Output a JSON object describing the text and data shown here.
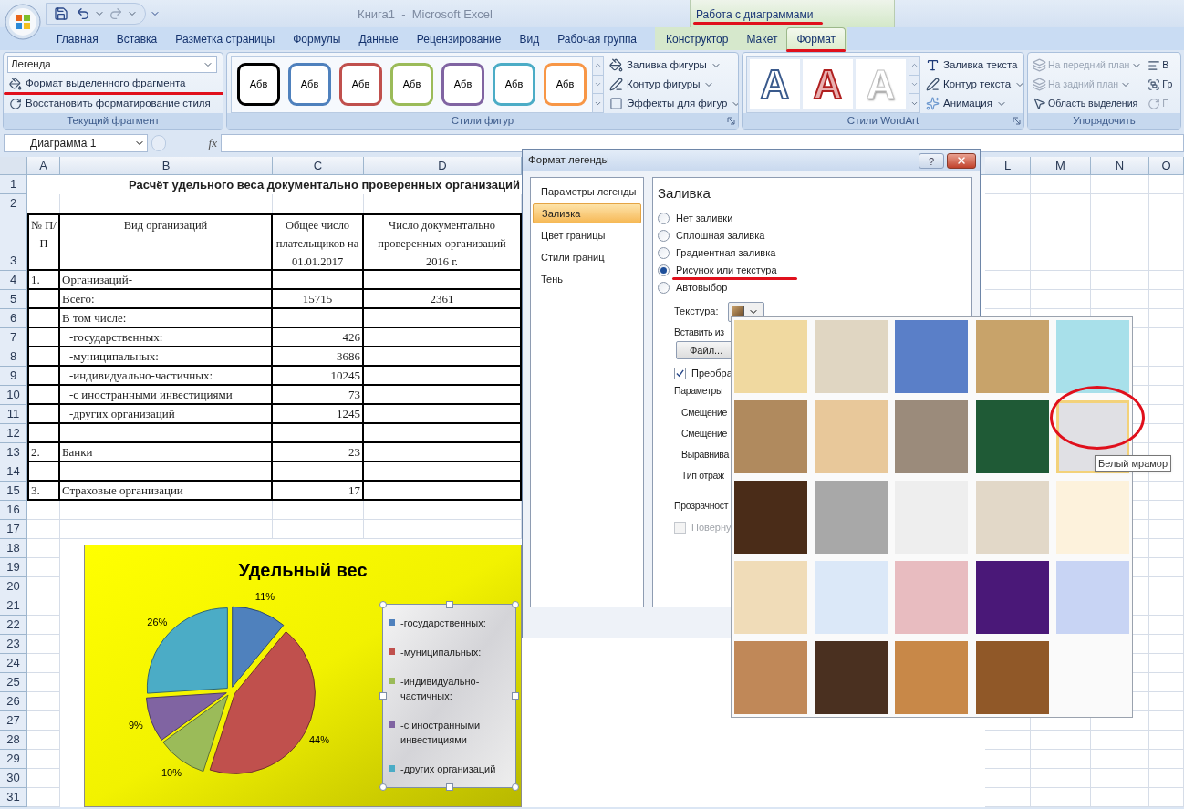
{
  "title_bar": {
    "document_title": "Книга1  -  Microsoft Excel",
    "context_group": "Работа с диаграммами",
    "context_annotated": true
  },
  "tabs": [
    {
      "label": "Главная",
      "selected": false,
      "contextual": false,
      "annotated": false
    },
    {
      "label": "Вставка",
      "selected": false,
      "contextual": false,
      "annotated": false
    },
    {
      "label": "Разметка страницы",
      "selected": false,
      "contextual": false,
      "annotated": false
    },
    {
      "label": "Формулы",
      "selected": false,
      "contextual": false,
      "annotated": false
    },
    {
      "label": "Данные",
      "selected": false,
      "contextual": false,
      "annotated": false
    },
    {
      "label": "Рецензирование",
      "selected": false,
      "contextual": false,
      "annotated": false
    },
    {
      "label": "Вид",
      "selected": false,
      "contextual": false,
      "annotated": false
    },
    {
      "label": "Рабочая группа",
      "selected": false,
      "contextual": false,
      "annotated": false
    },
    {
      "label": "Конструктор",
      "selected": false,
      "contextual": true,
      "annotated": false
    },
    {
      "label": "Макет",
      "selected": false,
      "contextual": true,
      "annotated": false
    },
    {
      "label": "Формат",
      "selected": true,
      "contextual": true,
      "annotated": true
    }
  ],
  "ribbon": {
    "current_selection": {
      "label": "Текущий фрагмент",
      "element_dropdown": "Легенда",
      "buttons": [
        {
          "label": "Формат выделенного фрагмента",
          "annotated": true
        },
        {
          "label": "Восстановить форматирование стиля",
          "annotated": false
        }
      ]
    },
    "shape_styles": {
      "label": "Стили фигур",
      "presets": [
        {
          "text": "Абв",
          "color": "#000000"
        },
        {
          "text": "Абв",
          "color": "#4f81bd"
        },
        {
          "text": "Абв",
          "color": "#c0504d"
        },
        {
          "text": "Абв",
          "color": "#9bbb59"
        },
        {
          "text": "Абв",
          "color": "#8064a2"
        },
        {
          "text": "Абв",
          "color": "#4bacc6"
        },
        {
          "text": "Абв",
          "color": "#f79646"
        }
      ],
      "commands": [
        "Заливка фигуры",
        "Контур фигуры",
        "Эффекты для фигур"
      ]
    },
    "wordart_styles": {
      "label": "Стили WordArt",
      "presets": [
        {
          "text": "A",
          "kind": "outline"
        },
        {
          "text": "A",
          "kind": "shadowed"
        },
        {
          "text": "A",
          "kind": "plain"
        }
      ],
      "commands": [
        "Заливка текста",
        "Контур текста",
        "Анимация"
      ]
    },
    "arrange": {
      "label": "Упорядочить",
      "commands": [
        {
          "label": "На передний план",
          "disabled": true
        },
        {
          "label": "На задний план",
          "disabled": true
        },
        {
          "label": "Область выделения",
          "disabled": false
        }
      ],
      "cut_commands": [
        "В",
        "Гр",
        "П"
      ]
    }
  },
  "formula_bar": {
    "name_box": "Диаграмма 1",
    "fx": "fx"
  },
  "sheet": {
    "columns_left": [
      "A",
      "B",
      "C",
      "D"
    ],
    "columns_right": [
      "L",
      "M",
      "N",
      "O"
    ],
    "rows": [
      {
        "number": "1",
        "kind": "title",
        "text": "Расчёт удельного веса документально проверенных организаций"
      },
      {
        "number": "2",
        "kind": "blank"
      },
      {
        "number": "3",
        "kind": "header",
        "cells": [
          "№ П/П",
          "Вид организаций",
          "Общее число плательщиков на 01.01.2017",
          "Число документально проверенных организаций 2016 г."
        ]
      },
      {
        "number": "4",
        "kind": "data",
        "indented": false,
        "a": "1.",
        "b": "Организаций-"
      },
      {
        "number": "5",
        "kind": "total",
        "indented": false,
        "b": "Всего:",
        "c": "15715",
        "d": "2361"
      },
      {
        "number": "6",
        "kind": "data",
        "indented": false,
        "b": "В том числе:"
      },
      {
        "number": "7",
        "kind": "data",
        "indented": true,
        "b": "-государственных:",
        "c": "426"
      },
      {
        "number": "8",
        "kind": "data",
        "indented": true,
        "b": "-муниципальных:",
        "c": "3686"
      },
      {
        "number": "9",
        "kind": "data",
        "indented": true,
        "b": "-индивидуально-частичных:",
        "c": "10245"
      },
      {
        "number": "10",
        "kind": "data",
        "indented": true,
        "b": "-с иностранными инвестициями",
        "c": "73"
      },
      {
        "number": "11",
        "kind": "data",
        "indented": true,
        "b": "-других организаций",
        "c": "1245"
      },
      {
        "number": "12",
        "kind": "data"
      },
      {
        "number": "13",
        "kind": "data",
        "indented": false,
        "a": "2.",
        "b": "Банки",
        "c": "23"
      },
      {
        "number": "14",
        "kind": "data"
      },
      {
        "number": "15",
        "kind": "data",
        "indented": false,
        "a": "3.",
        "b": "Страховые организации",
        "c": "17"
      },
      {
        "number": "16",
        "kind": "blank"
      },
      {
        "number": "17",
        "kind": "blank"
      },
      {
        "number": "18",
        "kind": "blank"
      },
      {
        "number": "19",
        "kind": "blank"
      },
      {
        "number": "20",
        "kind": "blank"
      },
      {
        "number": "21",
        "kind": "blank"
      },
      {
        "number": "22",
        "kind": "blank"
      },
      {
        "number": "23",
        "kind": "blank"
      },
      {
        "number": "24",
        "kind": "blank"
      },
      {
        "number": "25",
        "kind": "blank"
      },
      {
        "number": "26",
        "kind": "blank"
      },
      {
        "number": "27",
        "kind": "blank"
      },
      {
        "number": "28",
        "kind": "blank"
      },
      {
        "number": "29",
        "kind": "blank"
      },
      {
        "number": "30",
        "kind": "blank"
      },
      {
        "number": "31",
        "kind": "blank"
      }
    ]
  },
  "chart": {
    "legend": {
      "selected": true,
      "items": [
        {
          "label": "-государственных:",
          "color": "#4f81bd"
        },
        {
          "label": "-муниципальных:",
          "color": "#c0504d"
        },
        {
          "label": "-индивидуально-частичных:",
          "color": "#9bbb59"
        },
        {
          "label": "-с иностранными инвестициями",
          "color": "#8064a2"
        },
        {
          "label": "-других организаций",
          "color": "#4bacc6"
        }
      ]
    },
    "chart_data": {
      "type": "pie",
      "title": "Удельный вес",
      "values": [
        11,
        44,
        10,
        9,
        26
      ],
      "value_labels": [
        "11%",
        "44%",
        "10%",
        "9%",
        "26%"
      ]
    }
  },
  "dialog": {
    "title": "Формат легенды",
    "help": "?",
    "nav": [
      {
        "label": "Параметры легенды",
        "selected": false
      },
      {
        "label": "Заливка",
        "selected": true
      },
      {
        "label": "Цвет границы",
        "selected": false
      },
      {
        "label": "Стили границ",
        "selected": false
      },
      {
        "label": "Тень",
        "selected": false
      }
    ],
    "section_title": "Заливка",
    "fill_options": [
      {
        "label": "Нет заливки",
        "selected": false,
        "annotated": false
      },
      {
        "label": "Сплошная заливка",
        "selected": false,
        "annotated": false
      },
      {
        "label": "Градиентная заливка",
        "selected": false,
        "annotated": false
      },
      {
        "label": "Рисунок или текстура",
        "selected": true,
        "annotated": true
      },
      {
        "label": "Автовыбор",
        "selected": false,
        "annotated": false
      }
    ],
    "texture_label": "Текстура:",
    "insert_from": "Вставить из",
    "file_button": "Файл...",
    "tile_checkbox": {
      "label": "Преобра",
      "checked": true,
      "disabled": false
    },
    "tiling_label": "Параметры",
    "offset_labels": [
      "Смещение",
      "Смещение",
      "Выравнива",
      "Тип отраж"
    ],
    "transparency_label": "Прозрачност",
    "rotate_checkbox": {
      "label": "Поверну",
      "checked": false,
      "disabled": true
    }
  },
  "texture_gallery": {
    "tooltip": "Белый мрамор",
    "swatches": [
      {
        "color": "#f0d9a0",
        "selected": false,
        "circled": false
      },
      {
        "color": "#e0d6c2",
        "selected": false,
        "circled": false
      },
      {
        "color": "#5a7fc8",
        "selected": false,
        "circled": false
      },
      {
        "color": "#c8a36a",
        "selected": false,
        "circled": false
      },
      {
        "color": "#a8e0ea",
        "selected": false,
        "circled": false
      },
      {
        "color": "#b08a5e",
        "selected": false,
        "circled": false
      },
      {
        "color": "#e8c89a",
        "selected": false,
        "circled": false
      },
      {
        "color": "#9b8b7b",
        "selected": false,
        "circled": false
      },
      {
        "color": "#1f5a36",
        "selected": false,
        "circled": false
      },
      {
        "color": "#e0e0e4",
        "selected": true,
        "circled": true
      },
      {
        "color": "#4a2c18",
        "selected": false,
        "circled": false
      },
      {
        "color": "#a8a8a8",
        "selected": false,
        "circled": false
      },
      {
        "color": "#eeeeee",
        "selected": false,
        "circled": false
      },
      {
        "color": "#e2d8c8",
        "selected": false,
        "circled": false
      },
      {
        "color": "#fdf2dc",
        "selected": false,
        "circled": false
      },
      {
        "color": "#f0dcb8",
        "selected": false,
        "circled": false
      },
      {
        "color": "#dbe8f8",
        "selected": false,
        "circled": false
      },
      {
        "color": "#e8bcc0",
        "selected": false,
        "circled": false
      },
      {
        "color": "#4a1878",
        "selected": false,
        "circled": false
      },
      {
        "color": "#c8d4f4",
        "selected": false,
        "circled": false
      },
      {
        "color": "#c08858",
        "selected": false,
        "circled": false
      },
      {
        "color": "#4a3020",
        "selected": false,
        "circled": false
      },
      {
        "color": "#c88848",
        "selected": false,
        "circled": false
      },
      {
        "color": "#905828",
        "selected": false,
        "circled": false
      }
    ]
  }
}
